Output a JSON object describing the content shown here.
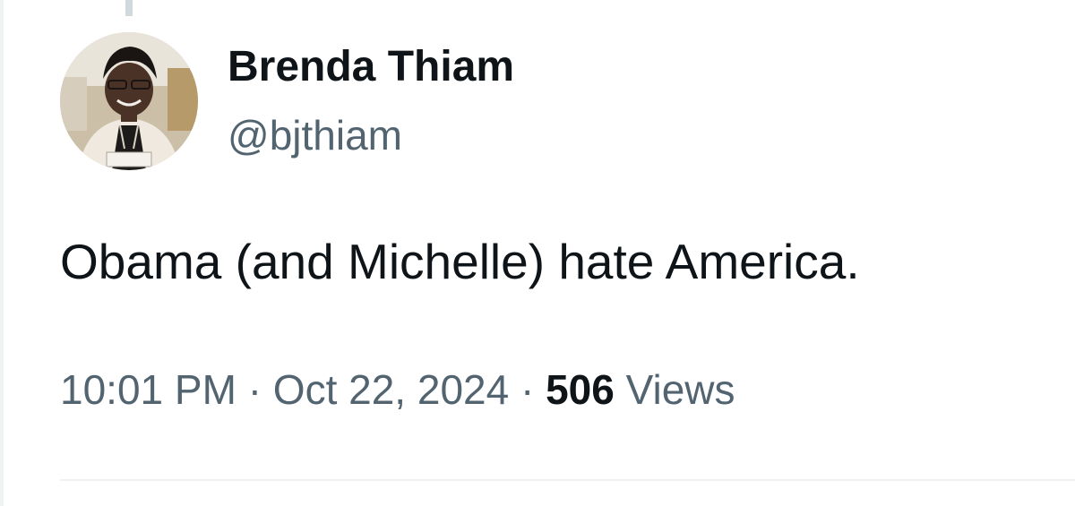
{
  "tweet": {
    "author": {
      "display_name": "Brenda Thiam",
      "handle": "@bjthiam",
      "avatar_icon": "profile-photo"
    },
    "text": "Obama (and Michelle) hate America.",
    "time": "10:01 PM",
    "separator": "·",
    "date": "Oct 22, 2024",
    "views_count": "506",
    "views_label": "Views"
  },
  "colors": {
    "primary_text": "#0f1419",
    "secondary_text": "#536471",
    "divider": "#eff3f4",
    "thread_line": "#cfd9de"
  }
}
